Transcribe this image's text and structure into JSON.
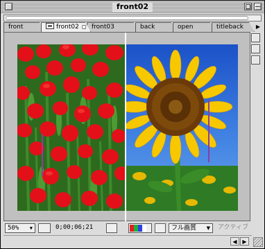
{
  "window": {
    "title": "front02"
  },
  "tabs": [
    {
      "label": "front",
      "active": false
    },
    {
      "label": "front02",
      "active": true
    },
    {
      "label": "front03",
      "active": false
    },
    {
      "label": "back",
      "active": false
    },
    {
      "label": "open",
      "active": false
    },
    {
      "label": "titleback",
      "active": false
    }
  ],
  "tab_menu_glyph": "◻",
  "tab_scroll_glyph": "▶",
  "toolbar": {
    "zoom": "50%",
    "zoom_arrow": "▼",
    "timecode": "0;00;06;21",
    "resolution": "フル画質",
    "resolution_arrow": "▼",
    "view_mode": "アクティブ"
  },
  "colors": {
    "swatch_red": "#e02020",
    "swatch_green": "#20b040",
    "swatch_blue": "#3040e0",
    "swatch_white": "#ffffff"
  },
  "icons": {
    "tab_icon": "composition-icon",
    "region_of_interest": "region-icon",
    "snapshot": "camera-icon",
    "channel": "rgb-channel-icon",
    "show_snapshot": "person-icon",
    "transparency_grid": "grid-icon"
  },
  "scroll": {
    "left": "◀",
    "right": "▶"
  }
}
